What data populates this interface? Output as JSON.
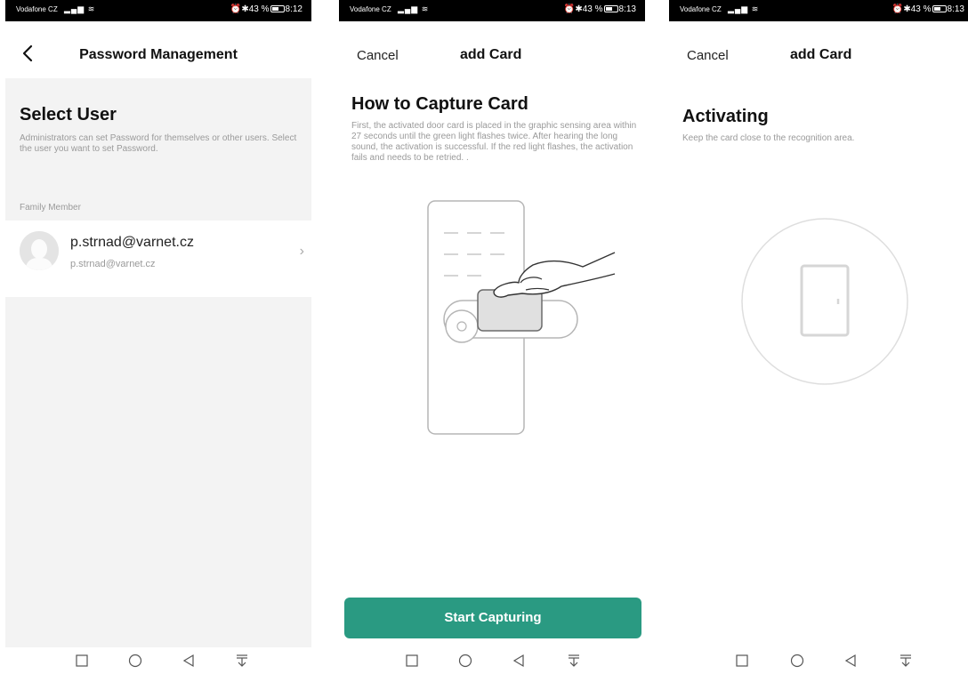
{
  "status": {
    "carrier": "Vodafone CZ",
    "battery": "43 %",
    "time1": "8:12",
    "time2": "8:13",
    "time3": "8:13"
  },
  "screen1": {
    "title": "Password Management",
    "heading": "Select User",
    "description": "Administrators can set Password for themselves or other users. Select the user you want to set Password.",
    "section_label": "Family Member",
    "user": {
      "name": "p.strnad@varnet.cz",
      "subtitle": "p.strnad@varnet.cz"
    }
  },
  "screen2": {
    "cancel_label": "Cancel",
    "title": "add Card",
    "heading": "How to Capture Card",
    "description": "First, the activated door card is placed in the graphic sensing area within 27 seconds until the green light flashes twice. After hearing the long sound, the activation is successful. If the red light flashes, the activation fails and needs to be retried. .",
    "button_label": "Start Capturing",
    "button_color": "#2a9a82"
  },
  "screen3": {
    "cancel_label": "Cancel",
    "title": "add Card",
    "heading": "Activating",
    "description": "Keep the card close to the recognition area."
  },
  "icons": {
    "back": "chevron-left-icon",
    "chevron": "chevron-right-icon",
    "sys_nav": [
      "square-icon",
      "circle-icon",
      "triangle-back-icon",
      "download-icon"
    ]
  }
}
